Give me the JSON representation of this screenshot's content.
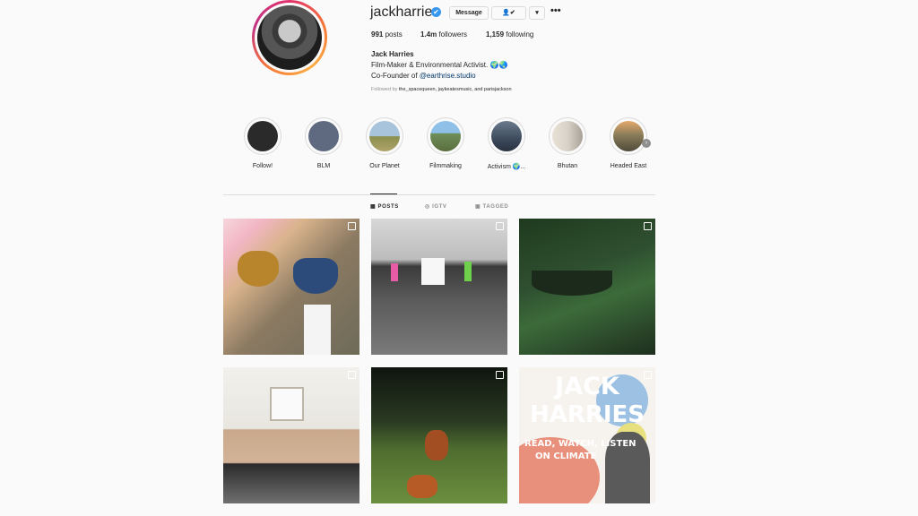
{
  "profile": {
    "username": "jackharries",
    "verified_icon": "✔",
    "message_label": "Message",
    "follow_icon_label": "👤✔",
    "caret_label": "▾",
    "more_label": "•••",
    "stats": {
      "posts_value": "991",
      "posts_label": " posts",
      "followers_value": "1.4m",
      "followers_label": " followers",
      "following_value": "1,159",
      "following_label": " following"
    },
    "full_name": "Jack Harries",
    "bio_line1": "Film-Maker & Environmental Activist. 🌍🌏",
    "bio_line2_prefix": "Co-Founder of ",
    "bio_link": "@earthrise.studio",
    "followed_prefix": "Followed by ",
    "followed_names": "the_spacequeen, jaykeatesmusic, and parisjackson"
  },
  "highlights": [
    {
      "label": "Follow!",
      "color": "#2a2a2a"
    },
    {
      "label": "BLM",
      "color": "#5f6a80"
    },
    {
      "label": "Our Planet",
      "color": "#a99b6f"
    },
    {
      "label": "Filmmaking",
      "color": "#6f8f5a"
    },
    {
      "label": "Activism 🌍...",
      "color": "#3c4a5c"
    },
    {
      "label": "Bhutan",
      "color": "#d8d2c8"
    },
    {
      "label": "Headed East",
      "color": "#6b6650"
    }
  ],
  "tabs": {
    "posts": "POSTS",
    "igtv": "IGTV",
    "tagged": "TAGGED"
  },
  "posts": {
    "p6_title_line1": "JACK",
    "p6_title_line2": "HARRIES",
    "p6_subtitle_line1": "READ, WATCH, LISTEN",
    "p6_subtitle_line2": "ON CLIMATE"
  },
  "colors": {
    "accent_blue": "#3897f0",
    "link_blue": "#00376b",
    "border": "#dbdbdb",
    "muted": "#8e8e8e",
    "text": "#262626"
  }
}
